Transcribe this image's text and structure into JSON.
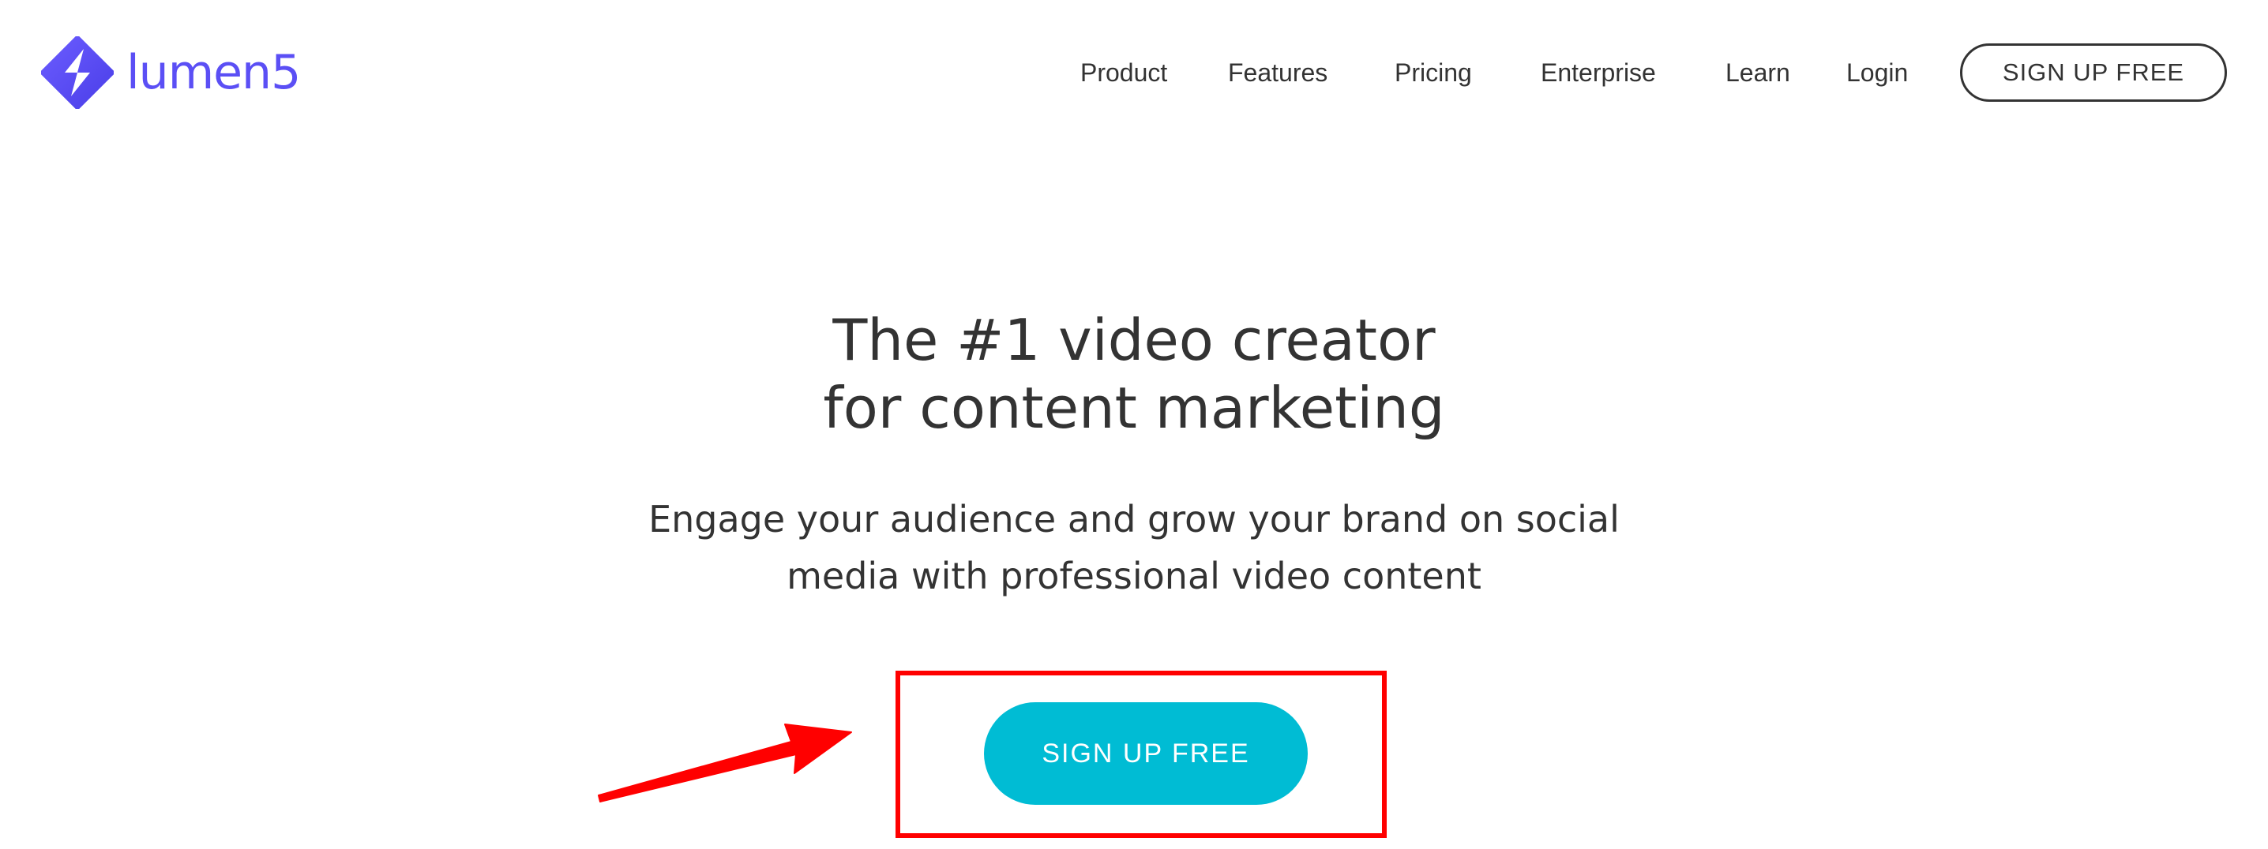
{
  "header": {
    "logo_text": "lumen5",
    "logo_icon": "lumen5-logo-icon",
    "nav": [
      {
        "label": "Product"
      },
      {
        "label": "Features"
      },
      {
        "label": "Pricing"
      },
      {
        "label": "Enterprise"
      },
      {
        "label": "Learn"
      },
      {
        "label": "Login"
      }
    ],
    "signup_label": "SIGN UP FREE"
  },
  "hero": {
    "title_line1": "The #1 video creator",
    "title_line2": "for content marketing",
    "subtitle_line1": "Engage your audience and grow your brand on social",
    "subtitle_line2": "media with professional video content",
    "cta_label": "SIGN UP FREE"
  },
  "annotation": {
    "arrow_icon": "red-arrow-icon",
    "highlight": "red-highlight-box"
  },
  "colors": {
    "brand": "#5b4ff5",
    "cta": "#00bcd4",
    "text": "#333333",
    "annotation": "#ff0000"
  }
}
